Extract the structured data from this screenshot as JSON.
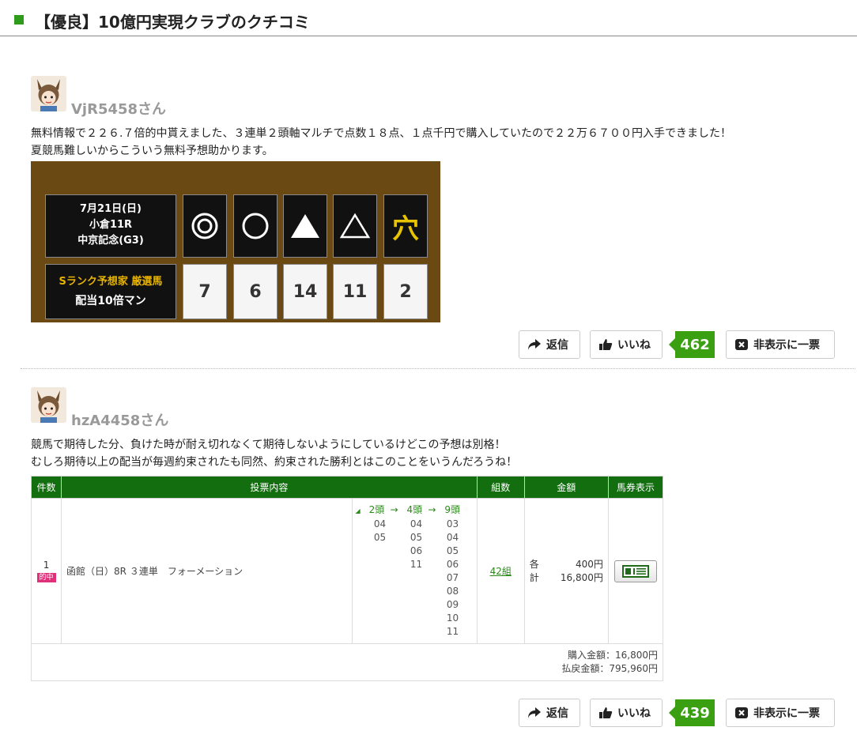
{
  "page": {
    "title": "【優良】10億円実現クラブのクチコミ"
  },
  "actions": {
    "reply": "返信",
    "like": "いいね",
    "hide": "非表示に一票"
  },
  "reviews": [
    {
      "user": "VjR5458さん",
      "lines": [
        "無料情報で２２６.７倍的中貰えました、３連単２頭軸マルチで点数１８点、１点千円で購入していたので２２万６７００円入手できました！",
        "夏競馬難しいからこういう無料予想助かります。"
      ],
      "race_image": {
        "date": "7月21日(日)",
        "race": "小倉11R",
        "name": "中京記念(G3)",
        "brand_top": "Sランク予想家 厳選馬",
        "brand_bottom": "配当10倍マン",
        "marks": [
          "◎",
          "○",
          "▲",
          "△",
          "穴"
        ],
        "numbers": [
          "7",
          "6",
          "14",
          "11",
          "2"
        ]
      },
      "likes": "462"
    },
    {
      "user": "hzA4458さん",
      "lines": [
        "競馬で期待した分、負けた時が耐え切れなくて期待しないようにしているけどこの予想は別格！",
        "むしろ期待以上の配当が毎週約束されたも同然、約束された勝利とはこのことをいうんだろうね！"
      ],
      "table": {
        "headers": [
          "件数",
          "投票内容",
          "組数",
          "金額",
          "馬券表示"
        ],
        "row": {
          "index": "1",
          "badge": "的中",
          "content": "函館（日）8R ３連単　フォーメーション",
          "formation_header": [
            "2頭",
            "4頭",
            "9頭"
          ],
          "col1": [
            "04",
            "05"
          ],
          "col2": [
            "04",
            "05",
            "06",
            "11"
          ],
          "col3": [
            "03",
            "04",
            "05",
            "06",
            "07",
            "08",
            "09",
            "10",
            "11"
          ],
          "kumi": "42組",
          "each_label": "各",
          "each_value": "400円",
          "total_label": "計",
          "total_value": "16,800円"
        },
        "purchase": "購入金額：16,800円",
        "payout": "払戻金額：795,960円"
      },
      "likes": "439"
    }
  ]
}
